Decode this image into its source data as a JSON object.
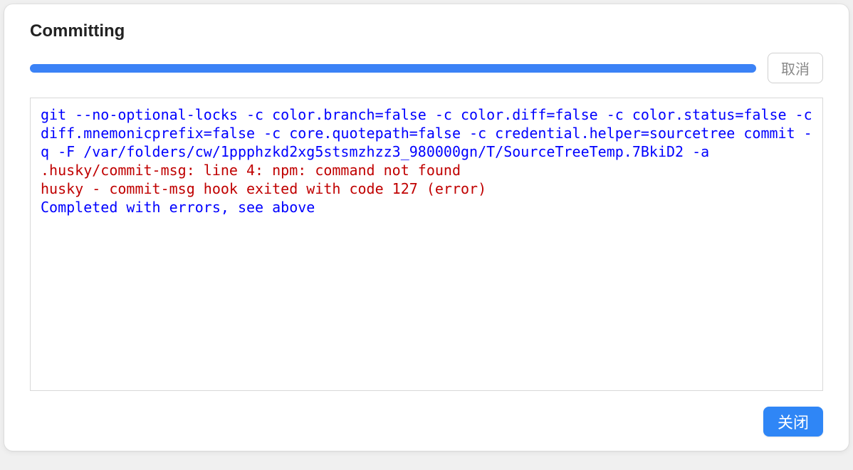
{
  "dialog": {
    "title": "Committing"
  },
  "buttons": {
    "cancel": "取消",
    "close": "关闭"
  },
  "output": {
    "command": "git --no-optional-locks -c color.branch=false -c color.diff=false -c color.status=false -c diff.mnemonicprefix=false -c core.quotepath=false -c credential.helper=sourcetree commit -q -F /var/folders/cw/1ppphzkd2xg5stsmzhzz3_980000gn/T/SourceTreeTemp.7BkiD2 -a",
    "error1": ".husky/commit-msg: line 4: npm: command not found",
    "error2": "husky - commit-msg hook exited with code 127 (error)",
    "completion": "Completed with errors, see above"
  }
}
